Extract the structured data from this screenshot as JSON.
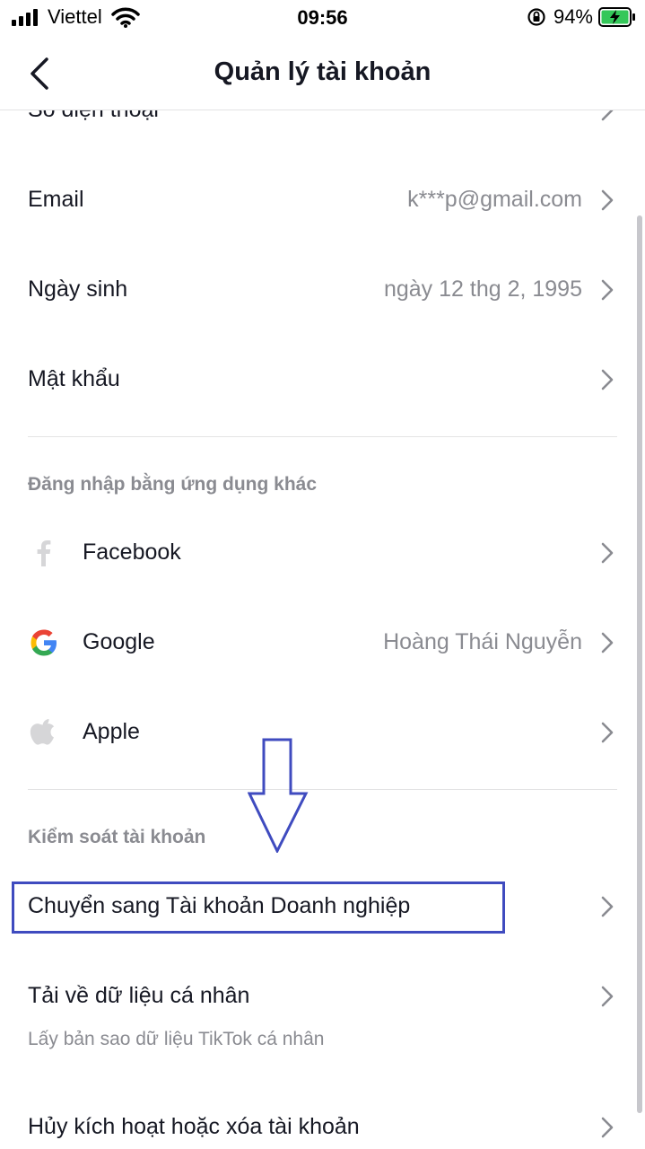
{
  "status": {
    "carrier": "Viettel",
    "time": "09:56",
    "battery": "94%"
  },
  "nav": {
    "title": "Quản lý tài khoản"
  },
  "account": {
    "phone_label": "Số điện thoại",
    "email_label": "Email",
    "email_value": "k***p@gmail.com",
    "birthday_label": "Ngày sinh",
    "birthday_value": "ngày 12 thg 2, 1995",
    "password_label": "Mật khẩu"
  },
  "login_section": {
    "title": "Đăng nhập bằng ứng dụng khác",
    "facebook_label": "Facebook",
    "google_label": "Google",
    "google_value": "Hoàng Thái Nguyễn",
    "apple_label": "Apple"
  },
  "control_section": {
    "title": "Kiểm soát tài khoản",
    "switch_business_label": "Chuyển sang Tài khoản Doanh nghiệp",
    "download_label": "Tải về dữ liệu cá nhân",
    "download_sub": "Lấy bản sao dữ liệu TikTok cá nhân",
    "deactivate_label": "Hủy kích hoạt hoặc xóa tài khoản"
  },
  "colors": {
    "annotation": "#3f4bbf",
    "text_primary": "#161823",
    "text_secondary": "#8a8b91",
    "battery_green": "#34c759"
  }
}
